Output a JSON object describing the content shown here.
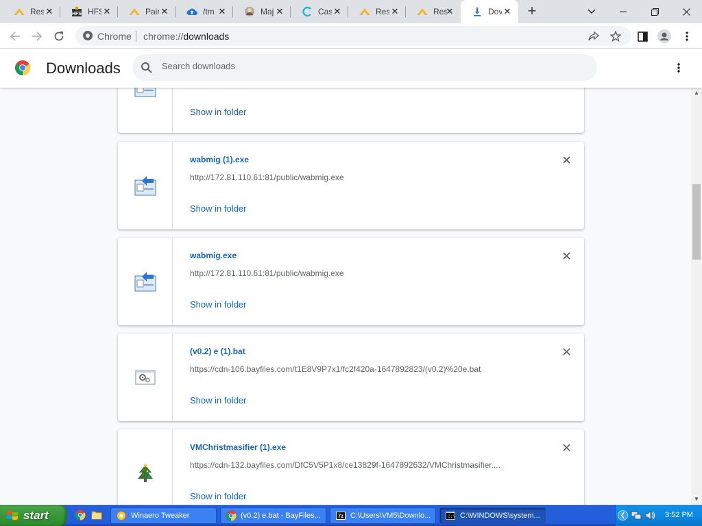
{
  "tabs": [
    {
      "title": "Res",
      "icon": "yellow-wing-icon",
      "active": false
    },
    {
      "title": "HFS",
      "icon": "hfs-icon",
      "active": false
    },
    {
      "title": "Pair",
      "icon": "yellow-wing-icon",
      "active": false
    },
    {
      "title": "/tm",
      "icon": "cloud-upload-icon",
      "active": false
    },
    {
      "title": "Maj",
      "icon": "avatar-icon",
      "active": false
    },
    {
      "title": "Cas",
      "icon": "c-logo-icon",
      "active": false
    },
    {
      "title": "Res",
      "icon": "yellow-wing-icon",
      "active": false
    },
    {
      "title": "Res",
      "icon": "yellow-wing-icon",
      "active": false
    },
    {
      "title": "Dov",
      "icon": "download-icon",
      "active": true
    }
  ],
  "omnibox": {
    "site": "Chrome",
    "url_scheme": "chrome://",
    "url_path": "downloads"
  },
  "downloads": {
    "title": "Downloads",
    "search_placeholder": "Search downloads",
    "show_in_folder": "Show in folder",
    "items": [
      {
        "name": "",
        "url": "",
        "icon": "installer-icon"
      },
      {
        "name": "wabmig (1).exe",
        "url": "http://172.81.110.61:81/public/wabmig.exe",
        "icon": "installer-icon"
      },
      {
        "name": "wabmig.exe",
        "url": "http://172.81.110.61:81/public/wabmig.exe",
        "icon": "installer-icon"
      },
      {
        "name": "(v0.2) e (1).bat",
        "url": "https://cdn-106.bayfiles.com/t1E8V9P7x1/fc2f420a-1647892823/(v0.2)%20e.bat",
        "icon": "batch-file-icon"
      },
      {
        "name": "VMChristmasifier (1).exe",
        "url": "https://cdn-132.bayfiles.com/DfC5V5P1x8/ce13829f-1647892632/VMChristmasifier....",
        "icon": "christmas-tree-icon"
      }
    ]
  },
  "taskbar": {
    "start_label": "start",
    "tasks": [
      {
        "label": "Winaero Tweaker",
        "icon": "winaero-icon",
        "active": false
      },
      {
        "label": "(v0.2) e.bat - BayFiles...",
        "icon": "chrome-icon",
        "active": false
      },
      {
        "label": "C:\\Users\\VM5\\Downlo...",
        "icon": "7zip-icon",
        "active": false
      },
      {
        "label": "C:\\WINDOWS\\system...",
        "icon": "cmd-icon",
        "active": true
      }
    ],
    "clock": "3:52 PM"
  },
  "colors": {
    "link": "#1a73e8",
    "tabstrip": "#dee1e6",
    "taskbar": "#245edb",
    "start": "#37973a"
  }
}
